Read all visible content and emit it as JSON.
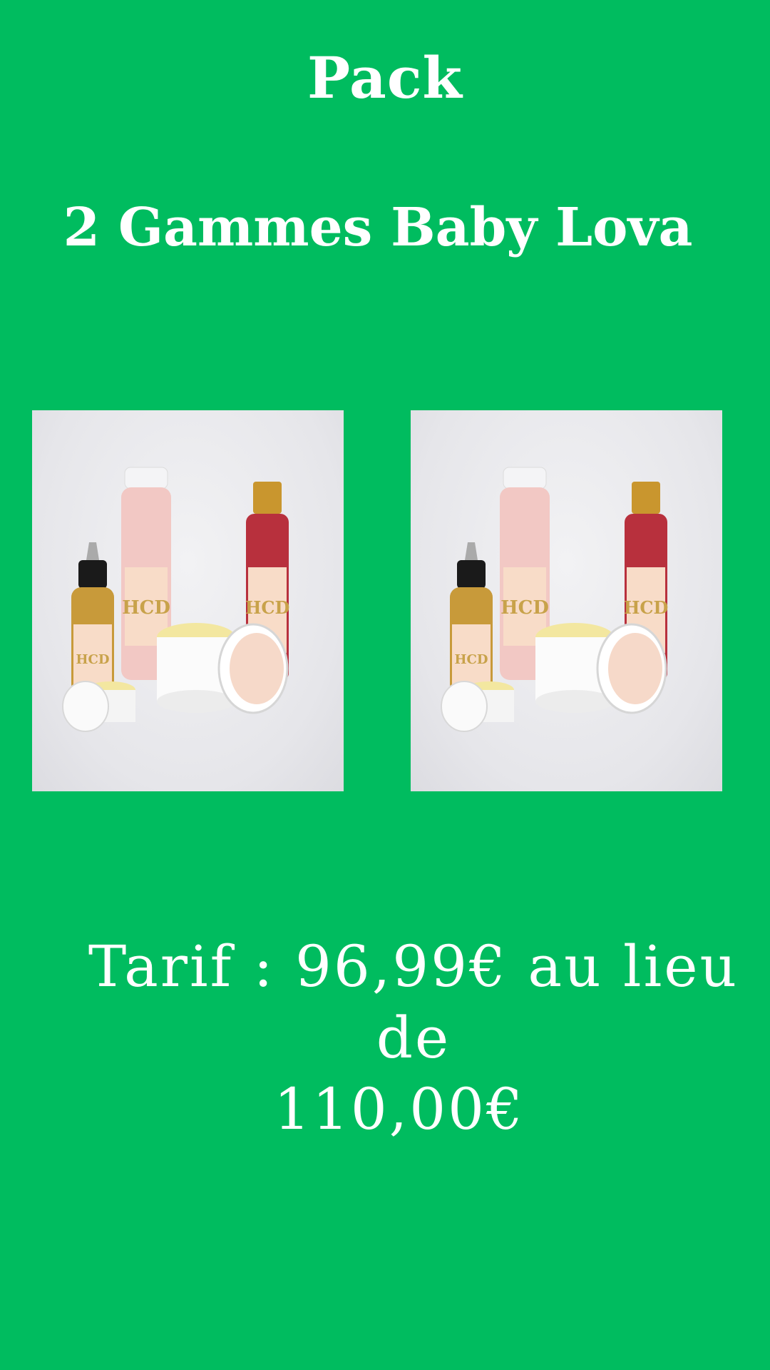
{
  "background_color": "#00bc5f",
  "text_color": "#ffffff",
  "header": {
    "title": "Pack",
    "subtitle": "2 Gammes Baby Lova"
  },
  "product_photos": [
    {
      "icon": "product-set-photo",
      "label_text": "HCD"
    },
    {
      "icon": "product-set-photo",
      "label_text": "HCD"
    }
  ],
  "price": {
    "line1": "Tarif : 96,99€ au lieu de",
    "line2": "110,00€"
  }
}
